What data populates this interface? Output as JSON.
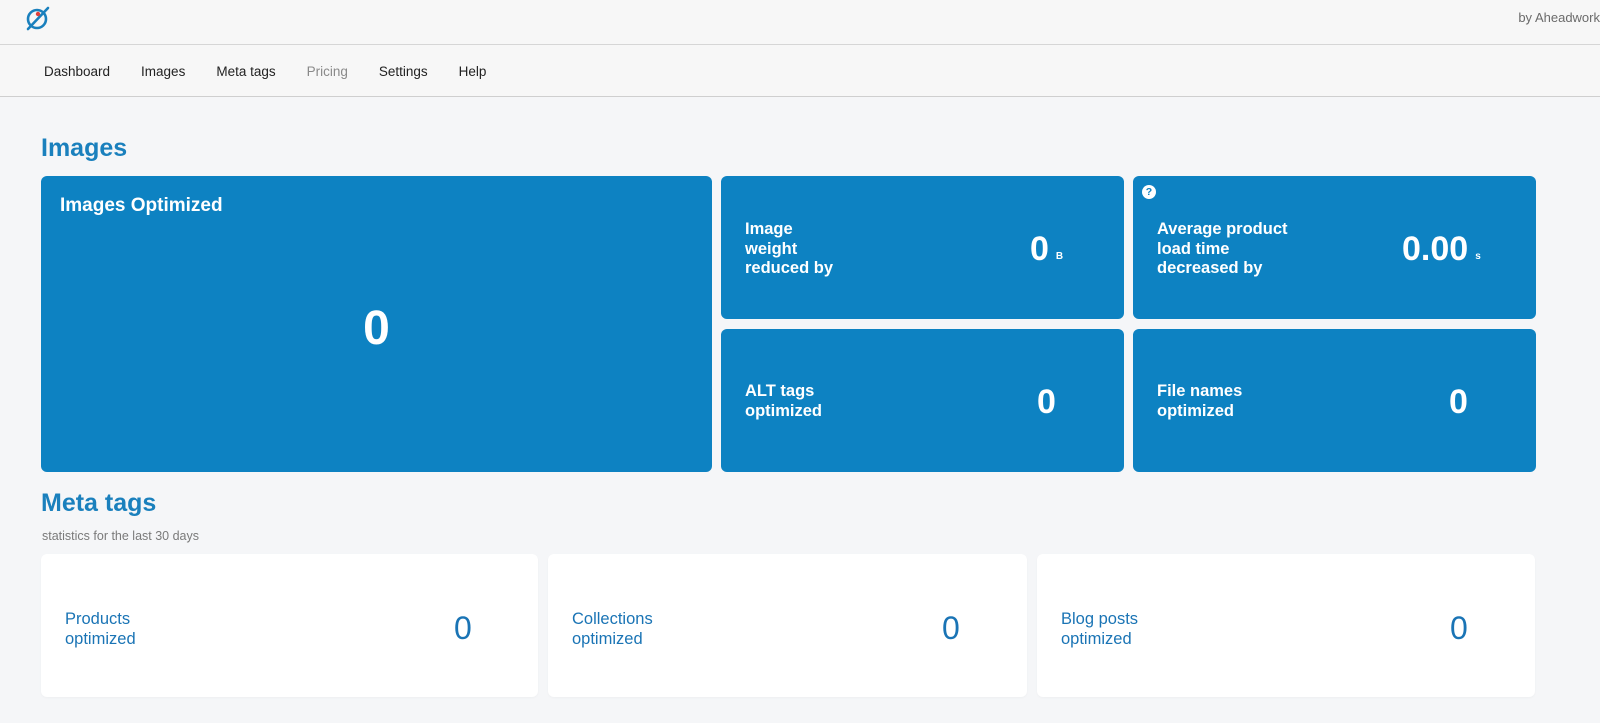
{
  "header": {
    "brand_by": "by Aheadwork"
  },
  "nav": {
    "items": [
      {
        "label": "Dashboard"
      },
      {
        "label": "Images"
      },
      {
        "label": "Meta tags"
      },
      {
        "label": "Pricing"
      },
      {
        "label": "Settings"
      },
      {
        "label": "Help"
      }
    ]
  },
  "images": {
    "title": "Images",
    "optimized": {
      "label": "Images Optimized",
      "value": "0"
    },
    "weight": {
      "label_lines": [
        "Image",
        "weight",
        "reduced by"
      ],
      "value": "0",
      "unit": "B"
    },
    "load_time": {
      "label_lines": [
        "Average product",
        "load time",
        "decreased by"
      ],
      "value": "0.00",
      "unit": "s",
      "help": "?"
    },
    "alt_tags": {
      "label_lines": [
        "ALT tags",
        "optimized"
      ],
      "value": "0"
    },
    "file_names": {
      "label_lines": [
        "File names",
        "optimized"
      ],
      "value": "0"
    }
  },
  "meta": {
    "title": "Meta tags",
    "subtitle": "statistics for the last 30 days",
    "products": {
      "label_lines": [
        "Products",
        "optimized"
      ],
      "value": "0"
    },
    "collections": {
      "label_lines": [
        "Collections",
        "optimized"
      ],
      "value": "0"
    },
    "blog_posts": {
      "label_lines": [
        "Blog posts",
        "optimized"
      ],
      "value": "0"
    }
  },
  "colors": {
    "accent": "#0d82c2",
    "accent_text": "#1a74b5",
    "background": "#f5f6f8"
  }
}
